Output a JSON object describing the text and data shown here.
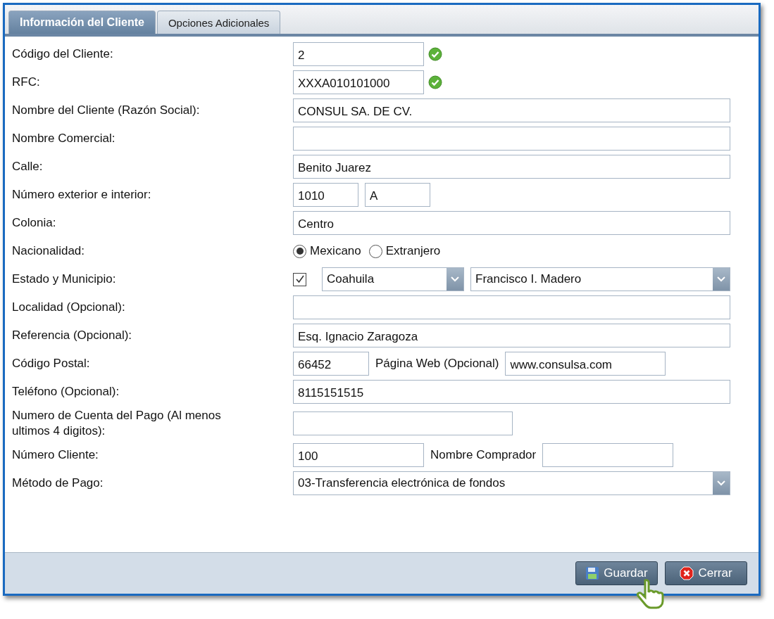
{
  "tabs": [
    {
      "label": "Información del Cliente",
      "selected": true
    },
    {
      "label": "Opciones Adicionales",
      "selected": false
    }
  ],
  "rows": [
    {
      "label": "Código del Cliente:",
      "controls": [
        {
          "kind": "field",
          "value": "2"
        },
        {
          "kind": "valid-icon"
        }
      ]
    },
    {
      "label": "RFC:",
      "controls": [
        {
          "kind": "field",
          "value": "XXXA010101000"
        },
        {
          "kind": "valid-icon"
        }
      ]
    },
    {
      "label": "Nombre del Cliente (Razón Social):",
      "controls": [
        {
          "kind": "wide-field",
          "value": "CONSUL SA. DE CV."
        }
      ]
    },
    {
      "label": "Nombre Comercial:",
      "controls": [
        {
          "kind": "wide-field"
        }
      ]
    },
    {
      "label": "Calle:",
      "controls": [
        {
          "kind": "wide-field",
          "value": "Benito Juarez"
        }
      ]
    },
    {
      "label": "Número exterior e interior:",
      "controls": [
        {
          "kind": "small-field",
          "value": "1010"
        },
        {
          "kind": "small-field",
          "value": "A"
        }
      ]
    },
    {
      "label": "Colonia:",
      "controls": [
        {
          "kind": "wide-field",
          "value": "Centro"
        }
      ]
    },
    {
      "label": "Nacionalidad:",
      "controls": [
        {
          "kind": "radio",
          "label": "Mexicano",
          "selected": true
        },
        {
          "kind": "radio",
          "label": "Extranjero",
          "selected": false
        }
      ]
    },
    {
      "label": "Estado y Municipio:",
      "controls": [
        {
          "kind": "checkbox",
          "checked": true
        },
        {
          "kind": "select",
          "value": "Coahuila"
        },
        {
          "kind": "wide-select",
          "value": "Francisco I. Madero"
        }
      ]
    },
    {
      "label": "Localidad (Opcional):",
      "controls": [
        {
          "kind": "wide-field"
        }
      ]
    },
    {
      "label": "Referencia (Opcional):",
      "controls": [
        {
          "kind": "wide-field",
          "value": "Esq. Ignacio Zaragoza"
        }
      ]
    },
    {
      "label": "Código Postal:",
      "controls": [
        {
          "kind": "mid-field",
          "value": "66452"
        },
        {
          "kind": "label",
          "text": "Página Web (Opcional)"
        },
        {
          "kind": "web-field",
          "value": "www.consulsa.com"
        }
      ]
    },
    {
      "label": "Teléfono (Opcional):",
      "controls": [
        {
          "kind": "wide-field",
          "value": "8115151515"
        }
      ]
    },
    {
      "label": "Numero de Cuenta del Pago (Al menos ultimos 4 digitos):",
      "controls": [
        {
          "kind": "long-field"
        }
      ]
    },
    {
      "label": "Número Cliente:",
      "controls": [
        {
          "kind": "field",
          "value": "100"
        },
        {
          "kind": "label",
          "text": "Nombre Comprador"
        },
        {
          "kind": "field"
        }
      ]
    },
    {
      "label": "Método de Pago:",
      "controls": [
        {
          "kind": "wide-select",
          "value": "03-Transferencia electrónica de fondos"
        }
      ]
    }
  ],
  "buttons": [
    {
      "kind": "save",
      "label": "Guardar"
    },
    {
      "kind": "close",
      "label": "Cerrar"
    }
  ]
}
